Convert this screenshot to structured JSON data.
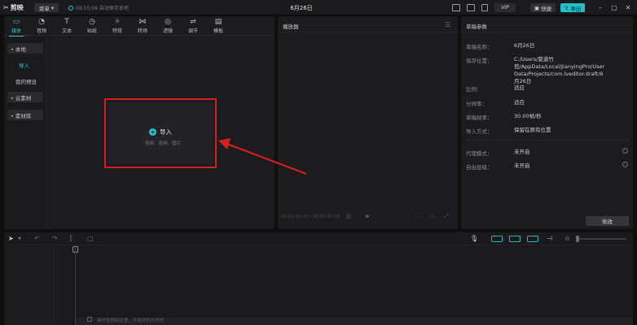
{
  "topbar": {
    "logo": "剪映",
    "menu_label": "菜单",
    "autosave": "09:55:09 自动保存本地",
    "title": "6月26日",
    "vip": "VIP",
    "shortcut": "快捷",
    "export": "导出"
  },
  "toolbar": {
    "tabs": [
      {
        "label": "媒体",
        "icon": "media-icon"
      },
      {
        "label": "音频",
        "icon": "audio-icon"
      },
      {
        "label": "文本",
        "icon": "text-icon"
      },
      {
        "label": "贴纸",
        "icon": "sticker-icon"
      },
      {
        "label": "特效",
        "icon": "effects-icon"
      },
      {
        "label": "转场",
        "icon": "transition-icon"
      },
      {
        "label": "滤镜",
        "icon": "filter-icon"
      },
      {
        "label": "调节",
        "icon": "adjust-icon"
      },
      {
        "label": "模板",
        "icon": "template-icon"
      }
    ]
  },
  "sidebar": {
    "items": [
      {
        "label": "• 本地"
      },
      {
        "label": "导入"
      },
      {
        "label": "我的预设"
      },
      {
        "label": "• 云素材"
      },
      {
        "label": "• 素材库"
      }
    ]
  },
  "import": {
    "label": "导入",
    "sub": "视频、音频、图片"
  },
  "player": {
    "title": "播放器",
    "timecode": "00:00:00:00 / 00:00:00:00"
  },
  "params": {
    "title": "草稿参数",
    "rows": [
      {
        "label": "草稿名称：",
        "value": "6月26日"
      },
      {
        "label": "保存位置：",
        "value": "C:/Users/莫道竹苞/AppData/Local/JianyingPro/User Data/Projects/com.lveditor.draft/6月26日"
      },
      {
        "label": "比例：",
        "value": "适应"
      },
      {
        "label": "分辨率：",
        "value": "适应"
      },
      {
        "label": "草稿帧率：",
        "value": "30.00帧/秒"
      },
      {
        "label": "导入方式：",
        "value": "保留在原有位置"
      },
      {
        "label": "代理模式：",
        "value": "未开启"
      },
      {
        "label": "自由层级：",
        "value": "未开启"
      }
    ],
    "modify": "修改"
  },
  "timeline": {
    "drop_text": "素材拖拽到这里，开始你的大作吧"
  },
  "colors": {
    "accent": "#25c6d1",
    "highlight": "#d21f1f",
    "export_bg": "#20c0cc"
  }
}
